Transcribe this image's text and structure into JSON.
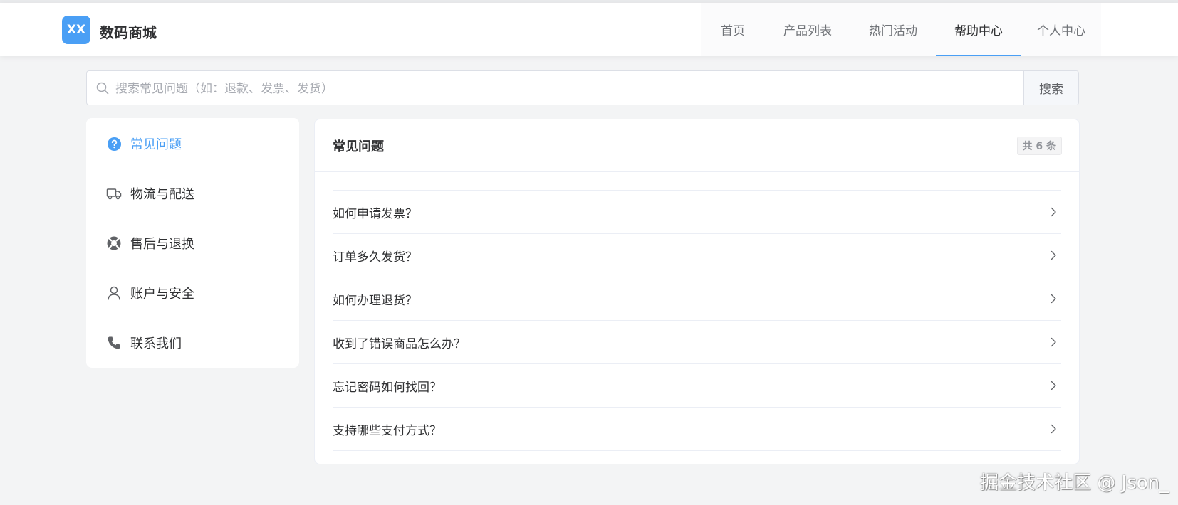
{
  "header": {
    "logo_text": "XX",
    "brand": "数码商城",
    "nav": [
      "首页",
      "产品列表",
      "热门活动",
      "帮助中心",
      "个人中心"
    ],
    "active_nav": "帮助中心",
    "accent_color": "#4a9ff5"
  },
  "search": {
    "placeholder": "搜索常见问题（如：退款、发票、发货）",
    "button_label": "搜索",
    "icon": "search-icon"
  },
  "sidebar": {
    "items": [
      {
        "label": "常见问题",
        "icon": "question-circle-icon",
        "active": true
      },
      {
        "label": "物流与配送",
        "icon": "truck-icon",
        "active": false
      },
      {
        "label": "售后与退换",
        "icon": "lifebuoy-icon",
        "active": false
      },
      {
        "label": "账户与安全",
        "icon": "user-icon",
        "active": false
      },
      {
        "label": "联系我们",
        "icon": "phone-icon",
        "active": false
      }
    ]
  },
  "main": {
    "title": "常见问题",
    "count_label": "共 6 条",
    "questions": [
      "如何申请发票？",
      "订单多久发货？",
      "如何办理退货？",
      "收到了错误商品怎么办？",
      "忘记密码如何找回？",
      "支持哪些支付方式？"
    ]
  },
  "watermark": "掘金技术社区 @ Json_"
}
